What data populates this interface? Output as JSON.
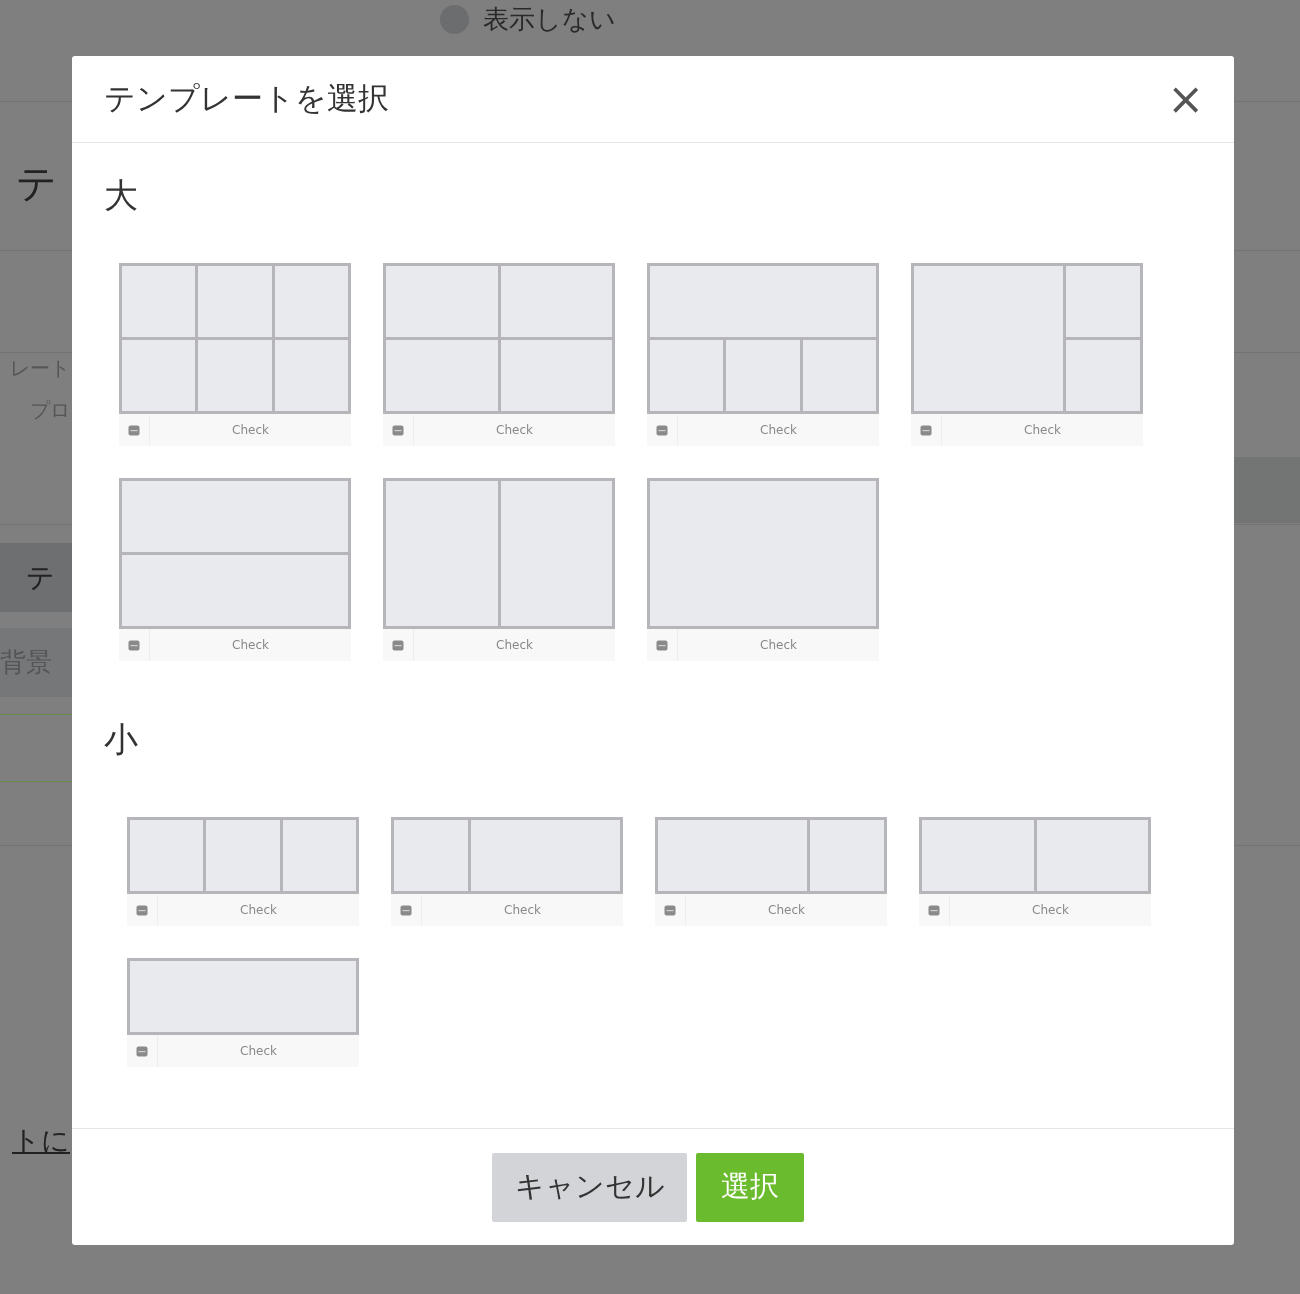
{
  "background": {
    "radio": {
      "label": "表示しない",
      "selected": false
    },
    "heading": "テ",
    "labels": [
      "レート",
      "プロ"
    ],
    "tabs": [
      {
        "label": "テ",
        "selected": true
      },
      {
        "label": "背景",
        "selected": false
      }
    ],
    "link": "トに"
  },
  "dialog": {
    "title": "テンプレートを選択",
    "close": "×",
    "sections": [
      {
        "title": "大",
        "kind": "large",
        "templates": [
          {
            "kind": "grid6",
            "label": "Check"
          },
          {
            "kind": "grid4",
            "label": "Check"
          },
          {
            "kind": "top1bottom3",
            "label": "Check"
          },
          {
            "kind": "left1right2",
            "label": "Check"
          },
          {
            "kind": "rows2",
            "label": "Check"
          },
          {
            "kind": "cols2",
            "label": "Check"
          },
          {
            "kind": "single",
            "label": "Check"
          }
        ]
      },
      {
        "title": "小",
        "kind": "small",
        "templates": [
          {
            "kind": "cols3",
            "label": "Check"
          },
          {
            "kind": "narrow-wide",
            "label": "Check"
          },
          {
            "kind": "wide-narrow",
            "label": "Check"
          },
          {
            "kind": "cols2",
            "label": "Check"
          },
          {
            "kind": "single",
            "label": "Check"
          }
        ]
      }
    ],
    "buttons": [
      {
        "kind": "cancel",
        "label": "キャンセル"
      },
      {
        "kind": "primary",
        "label": "選択"
      }
    ]
  }
}
